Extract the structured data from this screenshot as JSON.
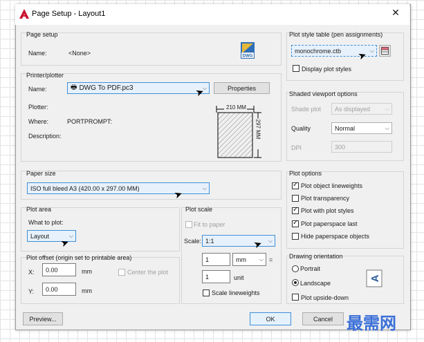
{
  "title": "Page Setup - Layout1",
  "page_setup": {
    "group": "Page setup",
    "name_label": "Name:",
    "name_value": "<None>",
    "icon_text": "DWG"
  },
  "printer": {
    "group": "Printer/plotter",
    "name_label": "Name:",
    "name_value": "DWG To PDF.pc3",
    "properties_btn": "Properties",
    "plotter_label": "Plotter:",
    "where_label": "Where:",
    "where_value": "PORTPROMPT:",
    "description_label": "Description:",
    "preview_width": "210 MM",
    "preview_height": "297 MM"
  },
  "paper_size": {
    "group": "Paper size",
    "value": "ISO full bleed A3 (420.00 x 297.00 MM)"
  },
  "plot_area": {
    "group": "Plot area",
    "what_label": "What to plot:",
    "value": "Layout"
  },
  "plot_offset": {
    "group": "Plot offset (origin set to printable area)",
    "x_label": "X:",
    "x_value": "0.00",
    "x_unit": "mm",
    "y_label": "Y:",
    "y_value": "0.00",
    "y_unit": "mm",
    "center_label": "Center the plot"
  },
  "plot_scale": {
    "group": "Plot scale",
    "fit_label": "Fit to paper",
    "scale_label": "Scale:",
    "scale_value": "1:1",
    "top_value": "1",
    "top_unit": "mm",
    "bottom_value": "1",
    "bottom_unit": "unit",
    "equals": "=",
    "lineweights_label": "Scale lineweights"
  },
  "plot_style_table": {
    "group": "Plot style table (pen assignments)",
    "value": "monochrome.ctb",
    "display_label": "Display plot styles"
  },
  "shaded": {
    "group": "Shaded viewport options",
    "shade_label": "Shade plot",
    "shade_value": "As displayed",
    "quality_label": "Quality",
    "quality_value": "Normal",
    "dpi_label": "DPI",
    "dpi_value": "300"
  },
  "plot_options": {
    "group": "Plot options",
    "items": [
      {
        "label": "Plot object lineweights",
        "checked": true
      },
      {
        "label": "Plot transparency",
        "checked": false
      },
      {
        "label": "Plot with plot styles",
        "checked": true
      },
      {
        "label": "Plot paperspace last",
        "checked": true
      },
      {
        "label": "Hide paperspace objects",
        "checked": false
      }
    ]
  },
  "orientation": {
    "group": "Drawing orientation",
    "portrait": "Portrait",
    "landscape": "Landscape",
    "upside_down": "Plot upside-down",
    "selected": "Landscape"
  },
  "buttons": {
    "preview": "Preview...",
    "ok": "OK",
    "cancel": "Cancel"
  },
  "watermark": "最需网",
  "colors": {
    "accent": "#3c8fd8",
    "highlight_bg": "#e7f1fb",
    "autocad_red": "#c8102e",
    "watermark": "#3a6fd8"
  }
}
